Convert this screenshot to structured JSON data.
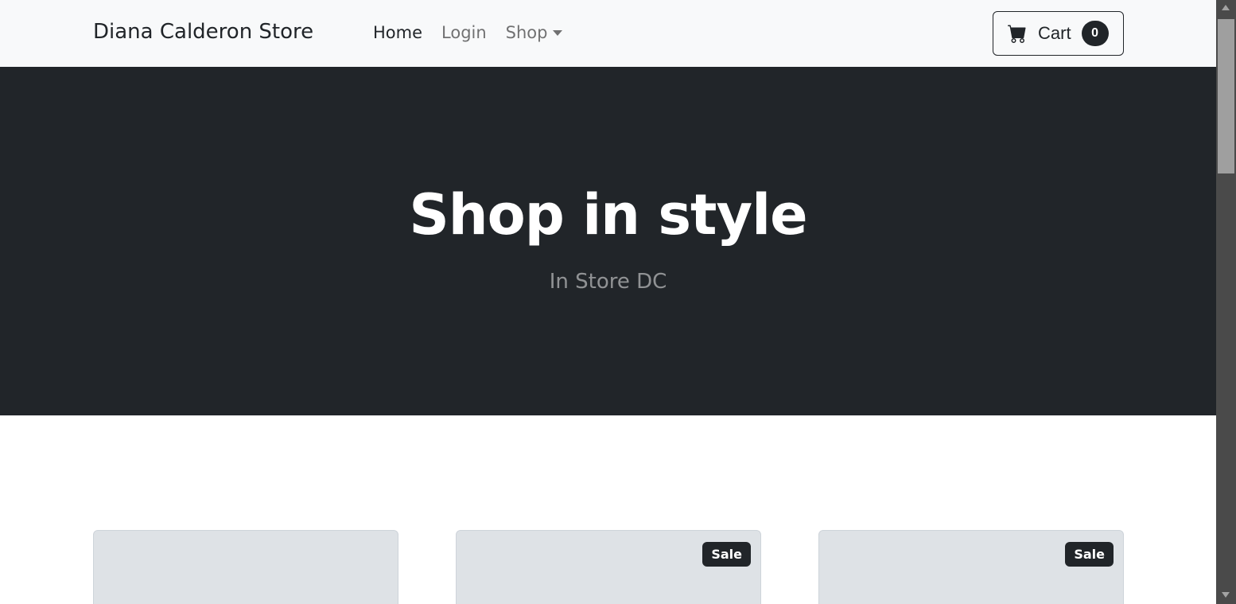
{
  "navbar": {
    "brand": "Diana Calderon Store",
    "links": [
      {
        "label": "Home",
        "active": true
      },
      {
        "label": "Login",
        "active": false
      }
    ],
    "shop_dropdown": {
      "label": "Shop",
      "icon": "caret-down-icon"
    },
    "cart": {
      "label": "Cart",
      "count": "0",
      "icon": "cart-icon"
    }
  },
  "hero": {
    "title": "Shop in style",
    "subtitle": "In Store DC"
  },
  "products": [
    {
      "badge": null
    },
    {
      "badge": "Sale"
    },
    {
      "badge": "Sale"
    }
  ],
  "colors": {
    "navbar_bg": "#f8f9fa",
    "hero_bg": "#212529",
    "card_bg": "#dee2e6",
    "badge_bg": "#212529"
  }
}
